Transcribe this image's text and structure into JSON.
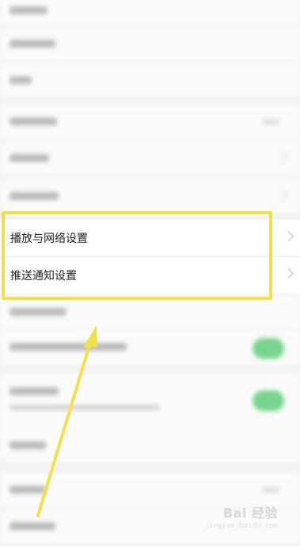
{
  "settings": {
    "highlighted_items": [
      {
        "label": "播放与网络设置"
      },
      {
        "label": "推送通知设置"
      }
    ]
  },
  "annotation": {
    "box_color": "#f2e04a",
    "arrow_color": "#f2e04a"
  },
  "watermark": {
    "main": "Bai 经验",
    "sub": "jingyan.baidu.com"
  },
  "colors": {
    "toggle_on": "#3cc45c",
    "row_bg": "#ffffff",
    "page_bg": "#f2f2f2"
  }
}
